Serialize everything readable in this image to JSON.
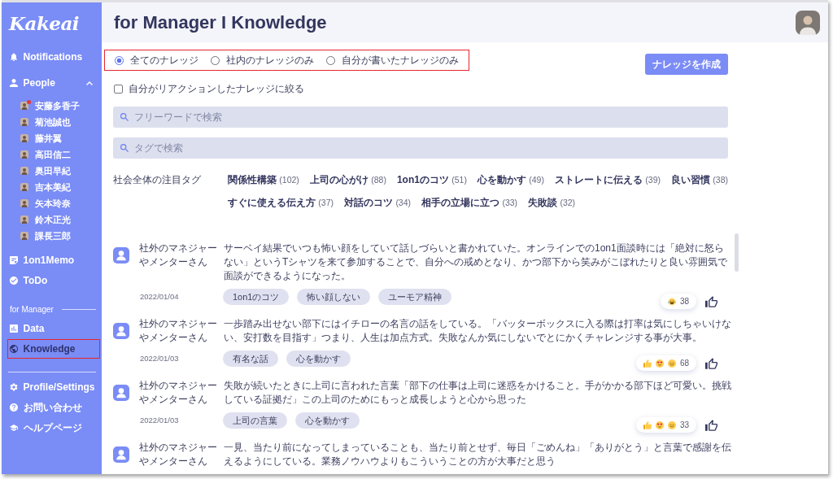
{
  "sidebar": {
    "logo": "Kakeai",
    "nav": [
      {
        "kind": "notifications",
        "label": "Notifications",
        "selected": false,
        "highlighted": false
      },
      {
        "kind": "people",
        "label": "People",
        "selected": false,
        "highlighted": false,
        "expanded": true,
        "children": [
          {
            "name": "安藤多香子",
            "unread": true,
            "selected": false
          },
          {
            "name": "菊池誠也",
            "unread": false,
            "selected": false
          },
          {
            "name": "藤井翼",
            "unread": false,
            "selected": false
          },
          {
            "name": "高田信二",
            "unread": false,
            "selected": false
          },
          {
            "name": "奥田早紀",
            "unread": false,
            "selected": false
          },
          {
            "name": "吉本美紀",
            "unread": false,
            "selected": false
          },
          {
            "name": "矢本玲奈",
            "unread": false,
            "selected": false
          },
          {
            "name": "鈴木正光",
            "unread": false,
            "selected": false
          },
          {
            "name": "課長三郎",
            "unread": false,
            "selected": false
          }
        ]
      },
      {
        "kind": "memo",
        "label": "1on1Memo",
        "selected": false,
        "highlighted": false
      },
      {
        "kind": "todo",
        "label": "ToDo",
        "selected": false,
        "highlighted": false
      }
    ],
    "manager_section": {
      "title": "for Manager",
      "items": [
        {
          "kind": "data",
          "label": "Data",
          "selected": false,
          "highlighted": false
        },
        {
          "kind": "knowledge",
          "label": "Knowledge",
          "selected": true,
          "highlighted": true
        }
      ]
    },
    "footer_nav": [
      {
        "kind": "settings",
        "label": "Profile/Settings",
        "selected": false,
        "highlighted": false
      },
      {
        "kind": "contact",
        "label": "お問い合わせ",
        "selected": false,
        "highlighted": false
      },
      {
        "kind": "help",
        "label": "ヘルプページ",
        "selected": false,
        "highlighted": false
      }
    ]
  },
  "header": {
    "title": "for Manager I Knowledge"
  },
  "filters": {
    "highlighted": true,
    "scope_options": [
      {
        "label": "全てのナレッジ",
        "selected": true
      },
      {
        "label": "社内のナレッジのみ",
        "selected": false
      },
      {
        "label": "自分が書いたナレッジのみ",
        "selected": false
      }
    ],
    "reacted_only": {
      "label": "自分がリアクションしたナレッジに絞る",
      "checked": false
    }
  },
  "create_button": {
    "label": "ナレッジを作成"
  },
  "keyword_search": {
    "placeholder": "フリーワードで検索"
  },
  "tag_search": {
    "placeholder": "タグで検索"
  },
  "trending_tags": {
    "title": "社会全体の注目タグ",
    "tags": [
      {
        "name": "関係性構築",
        "count": "(102)"
      },
      {
        "name": "上司の心がけ",
        "count": "(88)"
      },
      {
        "name": "1on1のコツ",
        "count": "(51)"
      },
      {
        "name": "心を動かす",
        "count": "(49)"
      },
      {
        "name": "ストレートに伝える",
        "count": "(39)"
      },
      {
        "name": "良い習慣",
        "count": "(38)"
      },
      {
        "name": "すぐに使える伝え方",
        "count": "(37)"
      },
      {
        "name": "対話のコツ",
        "count": "(34)"
      },
      {
        "name": "相手の立場に立つ",
        "count": "(33)"
      },
      {
        "name": "失敗談",
        "count": "(32)"
      }
    ]
  },
  "knowledge": [
    {
      "author": "社外のマネジャーやメンターさん",
      "date": "2022/01/04",
      "text": "サーベイ結果でいつも怖い顔をしていて話しづらいと書かれていた。オンラインでの1on1面談時には「絶対に怒らない」というTシャツを来て参加することで、自分への戒めとなり、かつ部下から笑みがこぼれたりと良い雰囲気で面談ができるようになった。",
      "tags": [
        "1on1のコツ",
        "怖い顔しない",
        "ユーモア精神"
      ],
      "reactions": {
        "emojis": [
          {
            "kind": "joy"
          }
        ],
        "count": "38"
      }
    },
    {
      "author": "社外のマネジャーやメンターさん",
      "date": "2022/01/03",
      "text": "一歩踏み出せない部下にはイチローの名言の話をしている。「バッターボックスに入る際は打率は気にしちゃいけない、安打数を目指す」つまり、人生は加点方式。失敗なんか気にしないでとにかくチャレンジする事が大事。",
      "tags": [
        "有名な話",
        "心を動かす"
      ],
      "reactions": {
        "emojis": [
          {
            "kind": "thumbs_up"
          },
          {
            "kind": "heart_eyes"
          },
          {
            "kind": "smile"
          }
        ],
        "count": "68"
      }
    },
    {
      "author": "社外のマネジャーやメンターさん",
      "date": "2022/01/03",
      "text": "失敗が続いたときに上司に言われた言葉「部下の仕事は上司に迷惑をかけること。手がかかる部下ほど可愛い。挑戦している証拠だ」この上司のためにもっと成長しようと心から思った",
      "tags": [
        "上司の言葉",
        "心を動かす"
      ],
      "reactions": {
        "emojis": [
          {
            "kind": "thumbs_up"
          },
          {
            "kind": "heart_eyes"
          },
          {
            "kind": "smile"
          }
        ],
        "count": "33"
      }
    },
    {
      "author": "社外のマネジャーやメンターさん",
      "text": "一見、当たり前になってしまっていることも、当たり前とせず、毎日「ごめんね」「ありがとう」と言葉で感謝を伝えるようにしている。業務ノウハウよりもこういうことの方が大事だと思う"
    }
  ]
}
